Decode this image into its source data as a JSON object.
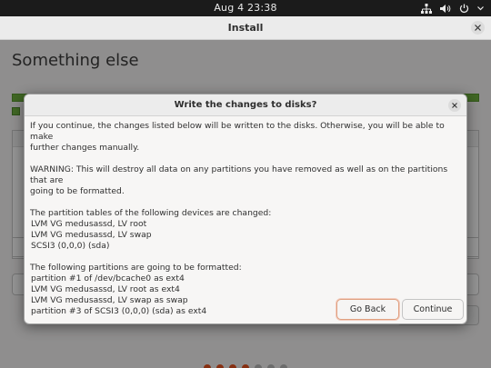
{
  "topbar": {
    "clock": "Aug 4  23:38"
  },
  "installer": {
    "title": "Install",
    "heading": "Something else"
  },
  "dialog": {
    "title": "Write the changes to disks?",
    "intro_line1": "If you continue, the changes listed below will be written to the disks. Otherwise, you will be able to make",
    "intro_line2": "further changes manually.",
    "warning_line1": "WARNING: This will destroy all data on any partitions you have removed as well as on the partitions that are",
    "warning_line2": "going to be formatted.",
    "tables_heading": "The partition tables of the following devices are changed:",
    "tables": [
      " LVM VG medusassd, LV root",
      " LVM VG medusassd, LV swap",
      " SCSI3 (0,0,0) (sda)"
    ],
    "format_heading": "The following partitions are going to be formatted:",
    "formats": [
      " partition #1 of /dev/bcache0 as ext4",
      " LVM VG medusassd, LV root as ext4",
      " LVM VG medusassd, LV swap as swap",
      " partition #3 of SCSI3 (0,0,0) (sda) as ext4"
    ],
    "go_back_label": "Go Back",
    "continue_label": "Continue"
  }
}
